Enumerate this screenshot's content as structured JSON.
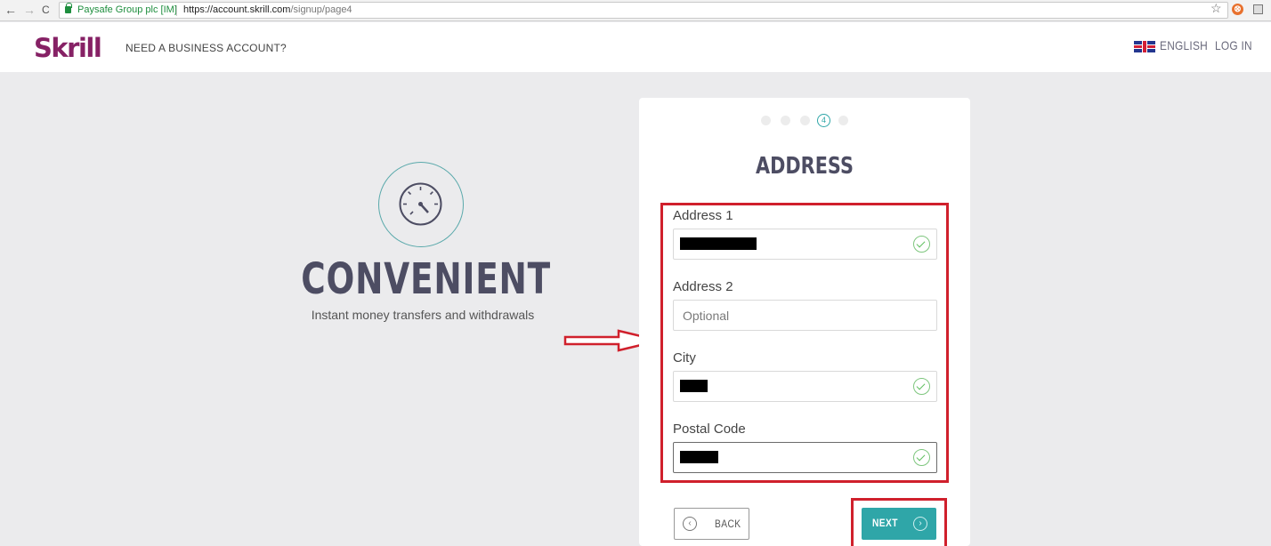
{
  "browser": {
    "back_icon": "←",
    "forward_icon": "→",
    "reload_icon": "C",
    "secure_label": "Paysafe Group plc [IM]",
    "url_host": "https://account.skrill.com",
    "url_path": "/signup/page4",
    "star_icon": "☆"
  },
  "header": {
    "logo": "Skrill",
    "business_link": "NEED A BUSINESS ACCOUNT?",
    "language": "ENGLISH",
    "login": "LOG IN"
  },
  "hero": {
    "icon": "speedometer-icon",
    "title": "CONVENIENT",
    "subtitle": "Instant money transfers and withdrawals"
  },
  "form": {
    "step_current": "4",
    "steps_total": 5,
    "title": "ADDRESS",
    "address1": {
      "label": "Address 1",
      "value_redacted": true
    },
    "address2": {
      "label": "Address 2",
      "placeholder": "Optional"
    },
    "city": {
      "label": "City",
      "value_redacted": true
    },
    "postal": {
      "label": "Postal Code",
      "value_redacted": true
    },
    "back_label": "BACK",
    "back_icon": "‹",
    "next_label": "NEXT",
    "next_icon": "›"
  },
  "colors": {
    "brand": "#862165",
    "accent": "#2fa6a8",
    "annotation": "#d0202c",
    "valid": "#5fbf5f"
  }
}
